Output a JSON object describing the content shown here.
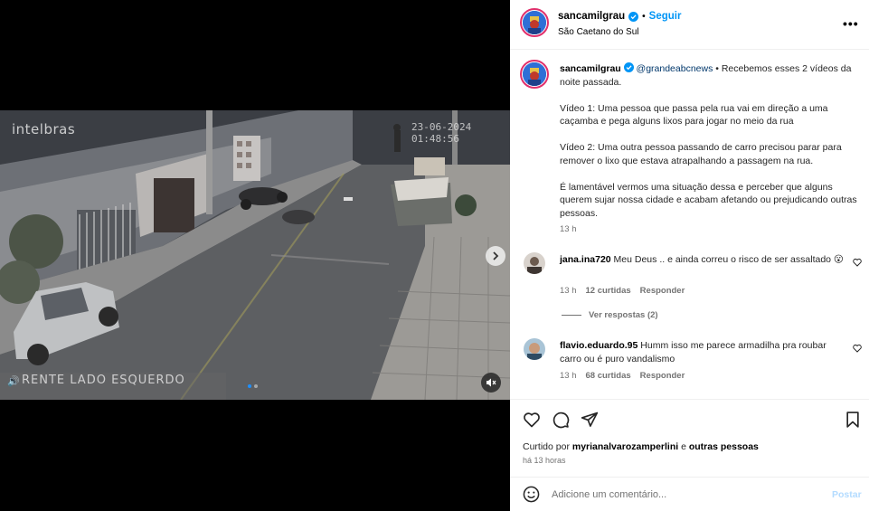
{
  "post": {
    "username": "sancamilgrau",
    "follow_label": "Seguir",
    "separator": "•",
    "location": "São Caetano do Sul",
    "more_icon": "•••"
  },
  "video": {
    "watermark": "intelbras",
    "timestamp": "23-06-2024 01:48:56",
    "camera_label": "RENTE LADO ESQUERDO",
    "slide_count": 2,
    "active_slide": 1
  },
  "caption": {
    "username": "sancamilgrau",
    "mention": "@grandeabcnews",
    "line1": " • Recebemos esses 2 vídeos da noite passada.",
    "para1": "Vídeo 1: Uma pessoa que passa pela rua vai em direção a uma caçamba e pega alguns lixos para jogar no meio da rua",
    "para2": "Vídeo 2: Uma outra pessoa passando de carro precisou parar para remover o lixo que estava atrapalhando a passagem na rua.",
    "para3": "É lamentável vermos uma situação dessa e perceber que alguns querem sujar nossa cidade e acabam afetando ou prejudicando outras pessoas.",
    "time": "13 h"
  },
  "comments": [
    {
      "username": "jana.ina720",
      "text": " Meu Deus .. e ainda correu o risco de ser assaltado 😮",
      "time": "13 h",
      "likes": "12 curtidas",
      "reply_label": "Responder",
      "view_replies": "Ver respostas (2)"
    },
    {
      "username": "flavio.eduardo.95",
      "text": " Humm isso me parece armadilha pra roubar carro ou é puro vandalismo",
      "time": "13 h",
      "likes": "68 curtidas",
      "reply_label": "Responder"
    }
  ],
  "actions": {
    "liked_prefix": "Curtido por ",
    "liked_user": "myrianalvarozamperlini",
    "liked_mid": " e ",
    "liked_others": "outras pessoas",
    "time_ago": "há 13 horas"
  },
  "add_comment": {
    "placeholder": "Adicione um comentário...",
    "post_label": "Postar"
  },
  "colors": {
    "accent_blue": "#0095f6",
    "verified_blue": "#0095f6",
    "post_disabled": "#b3dbff",
    "muted_text": "#737373"
  }
}
